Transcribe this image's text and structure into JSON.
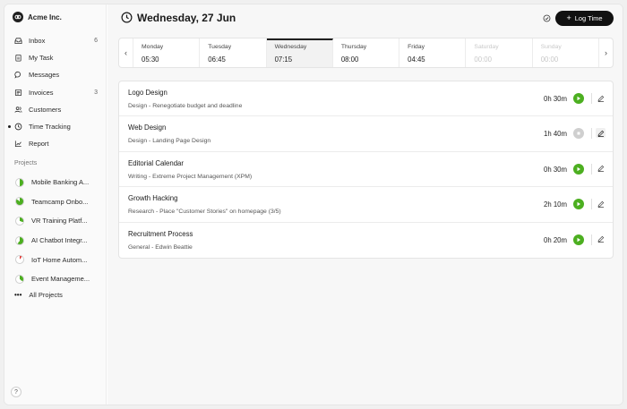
{
  "brand": {
    "name": "Acme Inc."
  },
  "nav": [
    {
      "label": "Inbox",
      "icon": "inbox-icon",
      "count": "6"
    },
    {
      "label": "My Task",
      "icon": "clipboard-icon",
      "count": ""
    },
    {
      "label": "Messages",
      "icon": "chat-icon",
      "count": ""
    },
    {
      "label": "Invoices",
      "icon": "invoice-icon",
      "count": "3"
    },
    {
      "label": "Customers",
      "icon": "users-icon",
      "count": ""
    },
    {
      "label": "Time Tracking",
      "icon": "clock-icon",
      "count": "",
      "active": true
    },
    {
      "label": "Report",
      "icon": "chart-icon",
      "count": ""
    }
  ],
  "projects_title": "Projects",
  "projects": [
    {
      "label": "Mobile Banking A...",
      "progress": 0.5
    },
    {
      "label": "Teamcamp Onbo...",
      "progress": 0.85
    },
    {
      "label": "VR Training Platf...",
      "progress": 0.3
    },
    {
      "label": "AI Chatbot Integr...",
      "progress": 0.6
    },
    {
      "label": "IoT Home Autom...",
      "progress": 0.1
    },
    {
      "label": "Event Manageme...",
      "progress": 0.35
    }
  ],
  "all_projects": "All Projects",
  "help": "?",
  "header": {
    "title": "Wednesday, 27 Jun",
    "log_button": "Log Time"
  },
  "week": [
    {
      "day": "Monday",
      "time": "05:30"
    },
    {
      "day": "Tuesday",
      "time": "06:45"
    },
    {
      "day": "Wednesday",
      "time": "07:15",
      "active": true
    },
    {
      "day": "Thursday",
      "time": "08:00"
    },
    {
      "day": "Friday",
      "time": "04:45"
    },
    {
      "day": "Saturday",
      "time": "00:00",
      "disabled": true
    },
    {
      "day": "Sunday",
      "time": "00:00",
      "disabled": true
    }
  ],
  "tasks": [
    {
      "title": "Logo Design",
      "subtitle": "Design - Renegotiate budget and deadline",
      "duration": "0h 30m",
      "running": false
    },
    {
      "title": "Web Design",
      "subtitle": "Design - Landing Page Design",
      "duration": "1h 40m",
      "running": true
    },
    {
      "title": "Editorial Calendar",
      "subtitle": "Writing - Extreme Project Management (XPM)",
      "duration": "0h 30m",
      "running": false
    },
    {
      "title": "Growth Hacking",
      "subtitle": "Research - Place \"Customer Stories\" on homepage (3/5)",
      "duration": "2h 10m",
      "running": false
    },
    {
      "title": "Recruitment Process",
      "subtitle": "General - Edwin Beattie",
      "duration": "0h 20m",
      "running": false
    }
  ],
  "colors": {
    "accent": "#4caf20",
    "dark": "#111111",
    "project_fill": "#4caf20",
    "project_red": "#e53935"
  }
}
